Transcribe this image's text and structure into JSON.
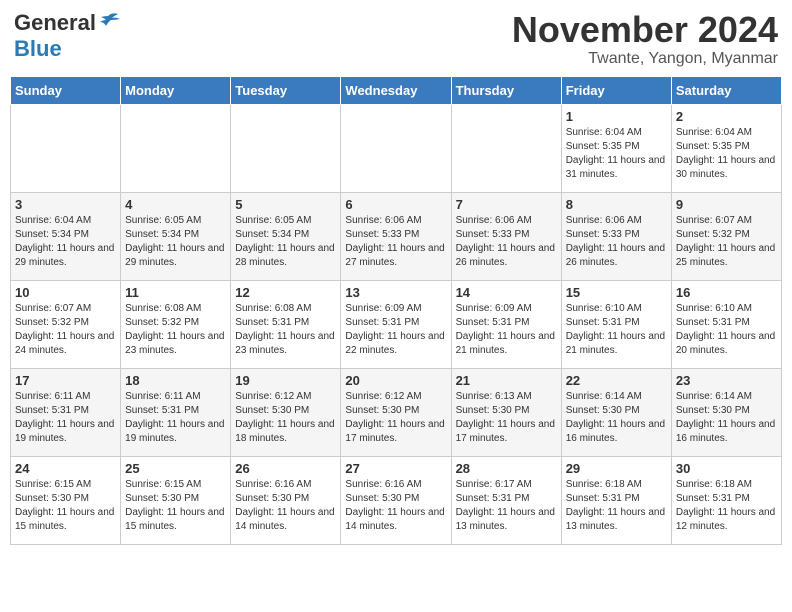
{
  "header": {
    "logo_general": "General",
    "logo_blue": "Blue",
    "month_title": "November 2024",
    "location": "Twante, Yangon, Myanmar"
  },
  "weekdays": [
    "Sunday",
    "Monday",
    "Tuesday",
    "Wednesday",
    "Thursday",
    "Friday",
    "Saturday"
  ],
  "weeks": [
    [
      {
        "day": "",
        "info": ""
      },
      {
        "day": "",
        "info": ""
      },
      {
        "day": "",
        "info": ""
      },
      {
        "day": "",
        "info": ""
      },
      {
        "day": "",
        "info": ""
      },
      {
        "day": "1",
        "info": "Sunrise: 6:04 AM\nSunset: 5:35 PM\nDaylight: 11 hours and 31 minutes."
      },
      {
        "day": "2",
        "info": "Sunrise: 6:04 AM\nSunset: 5:35 PM\nDaylight: 11 hours and 30 minutes."
      }
    ],
    [
      {
        "day": "3",
        "info": "Sunrise: 6:04 AM\nSunset: 5:34 PM\nDaylight: 11 hours and 29 minutes."
      },
      {
        "day": "4",
        "info": "Sunrise: 6:05 AM\nSunset: 5:34 PM\nDaylight: 11 hours and 29 minutes."
      },
      {
        "day": "5",
        "info": "Sunrise: 6:05 AM\nSunset: 5:34 PM\nDaylight: 11 hours and 28 minutes."
      },
      {
        "day": "6",
        "info": "Sunrise: 6:06 AM\nSunset: 5:33 PM\nDaylight: 11 hours and 27 minutes."
      },
      {
        "day": "7",
        "info": "Sunrise: 6:06 AM\nSunset: 5:33 PM\nDaylight: 11 hours and 26 minutes."
      },
      {
        "day": "8",
        "info": "Sunrise: 6:06 AM\nSunset: 5:33 PM\nDaylight: 11 hours and 26 minutes."
      },
      {
        "day": "9",
        "info": "Sunrise: 6:07 AM\nSunset: 5:32 PM\nDaylight: 11 hours and 25 minutes."
      }
    ],
    [
      {
        "day": "10",
        "info": "Sunrise: 6:07 AM\nSunset: 5:32 PM\nDaylight: 11 hours and 24 minutes."
      },
      {
        "day": "11",
        "info": "Sunrise: 6:08 AM\nSunset: 5:32 PM\nDaylight: 11 hours and 23 minutes."
      },
      {
        "day": "12",
        "info": "Sunrise: 6:08 AM\nSunset: 5:31 PM\nDaylight: 11 hours and 23 minutes."
      },
      {
        "day": "13",
        "info": "Sunrise: 6:09 AM\nSunset: 5:31 PM\nDaylight: 11 hours and 22 minutes."
      },
      {
        "day": "14",
        "info": "Sunrise: 6:09 AM\nSunset: 5:31 PM\nDaylight: 11 hours and 21 minutes."
      },
      {
        "day": "15",
        "info": "Sunrise: 6:10 AM\nSunset: 5:31 PM\nDaylight: 11 hours and 21 minutes."
      },
      {
        "day": "16",
        "info": "Sunrise: 6:10 AM\nSunset: 5:31 PM\nDaylight: 11 hours and 20 minutes."
      }
    ],
    [
      {
        "day": "17",
        "info": "Sunrise: 6:11 AM\nSunset: 5:31 PM\nDaylight: 11 hours and 19 minutes."
      },
      {
        "day": "18",
        "info": "Sunrise: 6:11 AM\nSunset: 5:31 PM\nDaylight: 11 hours and 19 minutes."
      },
      {
        "day": "19",
        "info": "Sunrise: 6:12 AM\nSunset: 5:30 PM\nDaylight: 11 hours and 18 minutes."
      },
      {
        "day": "20",
        "info": "Sunrise: 6:12 AM\nSunset: 5:30 PM\nDaylight: 11 hours and 17 minutes."
      },
      {
        "day": "21",
        "info": "Sunrise: 6:13 AM\nSunset: 5:30 PM\nDaylight: 11 hours and 17 minutes."
      },
      {
        "day": "22",
        "info": "Sunrise: 6:14 AM\nSunset: 5:30 PM\nDaylight: 11 hours and 16 minutes."
      },
      {
        "day": "23",
        "info": "Sunrise: 6:14 AM\nSunset: 5:30 PM\nDaylight: 11 hours and 16 minutes."
      }
    ],
    [
      {
        "day": "24",
        "info": "Sunrise: 6:15 AM\nSunset: 5:30 PM\nDaylight: 11 hours and 15 minutes."
      },
      {
        "day": "25",
        "info": "Sunrise: 6:15 AM\nSunset: 5:30 PM\nDaylight: 11 hours and 15 minutes."
      },
      {
        "day": "26",
        "info": "Sunrise: 6:16 AM\nSunset: 5:30 PM\nDaylight: 11 hours and 14 minutes."
      },
      {
        "day": "27",
        "info": "Sunrise: 6:16 AM\nSunset: 5:30 PM\nDaylight: 11 hours and 14 minutes."
      },
      {
        "day": "28",
        "info": "Sunrise: 6:17 AM\nSunset: 5:31 PM\nDaylight: 11 hours and 13 minutes."
      },
      {
        "day": "29",
        "info": "Sunrise: 6:18 AM\nSunset: 5:31 PM\nDaylight: 11 hours and 13 minutes."
      },
      {
        "day": "30",
        "info": "Sunrise: 6:18 AM\nSunset: 5:31 PM\nDaylight: 11 hours and 12 minutes."
      }
    ]
  ]
}
